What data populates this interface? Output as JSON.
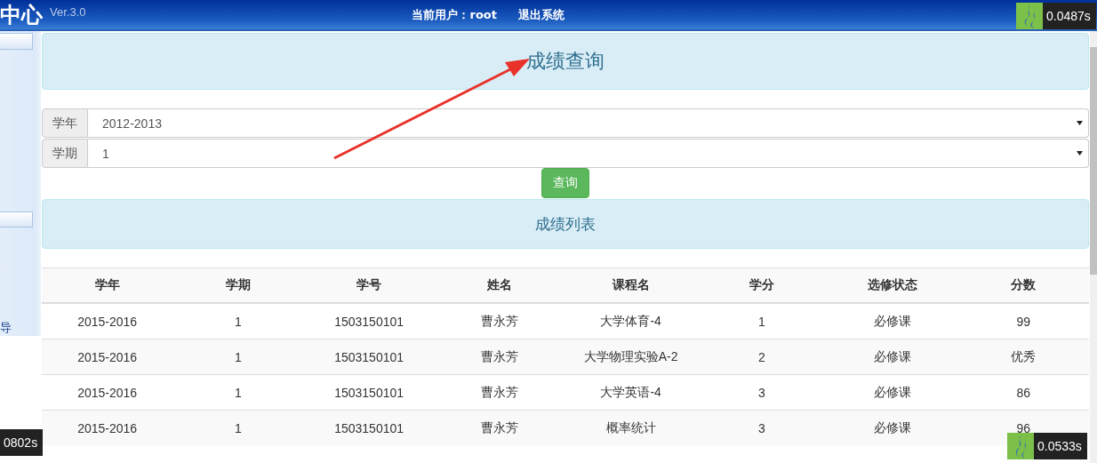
{
  "header": {
    "title": "中心",
    "version": "Ver.3.0",
    "user_label": "当前用户：root",
    "logout": "退出系统"
  },
  "sidebar": {
    "text": "导"
  },
  "page_title": "成绩查询",
  "filters": [
    {
      "label": "学年",
      "value": "2012-2013"
    },
    {
      "label": "学期",
      "value": "1"
    }
  ],
  "query_button": "查询",
  "list_title": "成绩列表",
  "table": {
    "columns": [
      "学年",
      "学期",
      "学号",
      "姓名",
      "课程名",
      "学分",
      "选修状态",
      "分数"
    ],
    "rows": [
      [
        "2015-2016",
        "1",
        "1503150101",
        "曹永芳",
        "大学体育-4",
        "1",
        "必修课",
        "99"
      ],
      [
        "2015-2016",
        "1",
        "1503150101",
        "曹永芳",
        "大学物理实验A-2",
        "2",
        "必修课",
        "优秀"
      ],
      [
        "2015-2016",
        "1",
        "1503150101",
        "曹永芳",
        "大学英语-4",
        "3",
        "必修课",
        "86"
      ],
      [
        "2015-2016",
        "1",
        "1503150101",
        "曹永芳",
        "概率统计",
        "3",
        "必修课",
        "96"
      ]
    ]
  },
  "timer_top_right": "0.0487s",
  "timer_bottom_left": "0802s",
  "timer_bottom_right": "0.0533s"
}
